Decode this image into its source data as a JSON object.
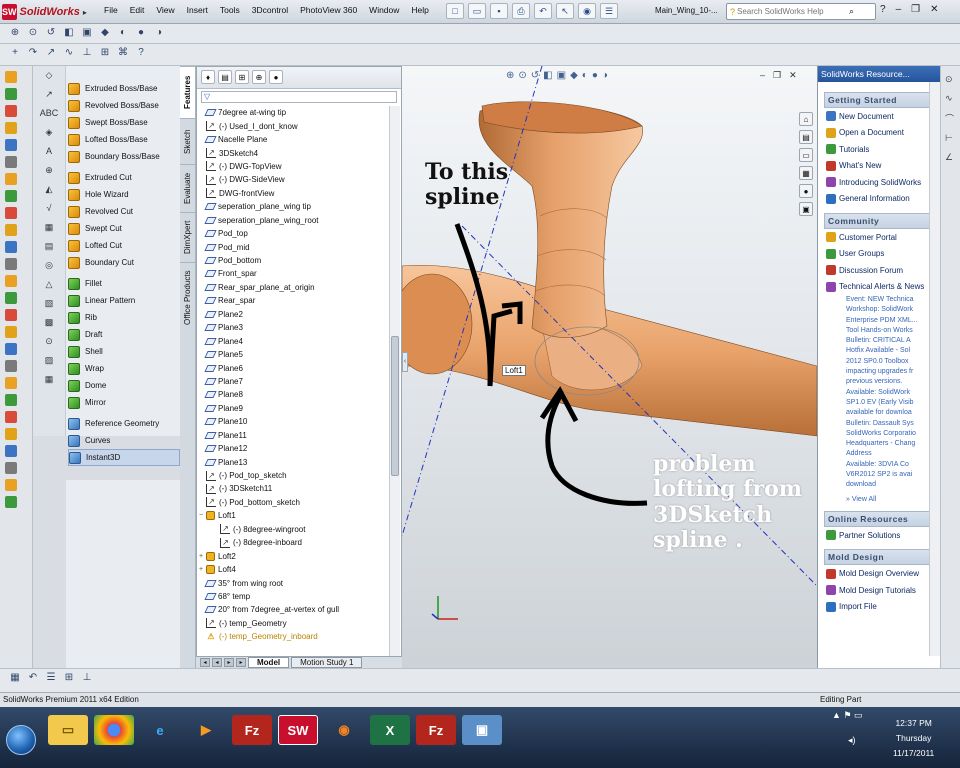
{
  "app": {
    "name": "SolidWorks",
    "badge": "SW",
    "document_title": "Main_Wing_10-..."
  },
  "menu": [
    "File",
    "Edit",
    "View",
    "Insert",
    "Tools",
    "3Dcontrol",
    "PhotoView 360",
    "Window",
    "Help"
  ],
  "search": {
    "placeholder": "Search SolidWorks Help"
  },
  "commands": {
    "group1": [
      "Extruded Boss/Base",
      "Revolved Boss/Base",
      "Swept Boss/Base",
      "Lofted Boss/Base",
      "Boundary Boss/Base"
    ],
    "group2": [
      "Extruded Cut",
      "Hole Wizard",
      "Revolved Cut",
      "Swept Cut",
      "Lofted Cut",
      "Boundary Cut"
    ],
    "group3": [
      "Fillet",
      "Linear Pattern",
      "Rib",
      "Draft",
      "Shell",
      "Wrap",
      "Dome",
      "Mirror"
    ],
    "group4": [
      "Reference Geometry",
      "Curves",
      "Instant3D"
    ]
  },
  "vertical_tabs": [
    "Features",
    "Sketch",
    "Evaluate",
    "DimXpert",
    "Office Products"
  ],
  "feature_tree": [
    {
      "type": "plane",
      "label": "7degree at-wing tip"
    },
    {
      "type": "sketch",
      "label": "(-) Used_I_dont_know"
    },
    {
      "type": "plane",
      "label": "Nacelle Plane"
    },
    {
      "type": "sketch",
      "label": "3DSketch4"
    },
    {
      "type": "sketch",
      "label": "(-) DWG-TopView"
    },
    {
      "type": "sketch",
      "label": "(-) DWG-SideView"
    },
    {
      "type": "sketch",
      "label": "DWG-frontView"
    },
    {
      "type": "plane",
      "label": "seperation_plane_wing tip"
    },
    {
      "type": "plane",
      "label": "seperation_plane_wing_root"
    },
    {
      "type": "plane",
      "label": "Pod_top"
    },
    {
      "type": "plane",
      "label": "Pod_mid"
    },
    {
      "type": "plane",
      "label": "Pod_bottom"
    },
    {
      "type": "plane",
      "label": "Front_spar"
    },
    {
      "type": "plane",
      "label": "Rear_spar_plane_at_origin"
    },
    {
      "type": "plane",
      "label": "Rear_spar"
    },
    {
      "type": "plane",
      "label": "Plane2"
    },
    {
      "type": "plane",
      "label": "Plane3"
    },
    {
      "type": "plane",
      "label": "Plane4"
    },
    {
      "type": "plane",
      "label": "Plane5"
    },
    {
      "type": "plane",
      "label": "Plane6"
    },
    {
      "type": "plane",
      "label": "Plane7"
    },
    {
      "type": "plane",
      "label": "Plane8"
    },
    {
      "type": "plane",
      "label": "Plane9"
    },
    {
      "type": "plane",
      "label": "Plane10"
    },
    {
      "type": "plane",
      "label": "Plane11"
    },
    {
      "type": "plane",
      "label": "Plane12"
    },
    {
      "type": "plane",
      "label": "Plane13"
    },
    {
      "type": "sketch",
      "label": "(-) Pod_top_sketch"
    },
    {
      "type": "sketch",
      "label": "(-) 3DSketch11"
    },
    {
      "type": "sketch",
      "label": "(-) Pod_bottom_sketch"
    },
    {
      "type": "loft",
      "label": "Loft1",
      "expand": "−"
    },
    {
      "type": "sketch",
      "label": "(-) 8degree-wingroot",
      "child": true
    },
    {
      "type": "sketch",
      "label": "(-) 8degree-inboard",
      "child": true
    },
    {
      "type": "loft",
      "label": "Loft2",
      "expand": "+"
    },
    {
      "type": "loft",
      "label": "Loft4",
      "expand": "+"
    },
    {
      "type": "plane",
      "label": "35° from wing root"
    },
    {
      "type": "plane",
      "label": "68° temp"
    },
    {
      "type": "plane",
      "label": "20° from 7degree_at-vertex of gull"
    },
    {
      "type": "sketch",
      "label": "(-) temp_Geometry"
    },
    {
      "type": "warn",
      "label": "(-) temp_Geometry_inboard"
    }
  ],
  "tree_tabs": [
    "Model",
    "Motion Study 1"
  ],
  "viewport": {
    "annotation_top": "To this\nspline",
    "annotation_bottom": "problem\nlofting from\n3DSketch\nspline .",
    "callout": "Loft1"
  },
  "resources": {
    "header": "SolidWorks Resource...",
    "sections": [
      {
        "title": "Getting Started",
        "items": [
          "New Document",
          "Open a Document",
          "Tutorials",
          "What's New",
          "Introducing SolidWorks",
          "General Information"
        ]
      },
      {
        "title": "Community",
        "items": [
          "Customer Portal",
          "User Groups",
          "Discussion Forum",
          "Technical Alerts & News"
        ]
      },
      {
        "title": "Online Resources",
        "items": [
          "Partner Solutions"
        ]
      },
      {
        "title": "Mold Design",
        "items": [
          "Mold Design Overview",
          "Mold Design Tutorials",
          "Import File"
        ]
      }
    ],
    "news": [
      "Event: NEW Technica",
      "Workshop: SolidWork",
      "Enterprise PDM XML...",
      "Tool Hands-on Works",
      "Bulletin: CRITICAL A",
      "Hotfix Available - Sol",
      "2012 SP0.0 Toolbox",
      "impacting upgrades fr",
      "previous versions.",
      "Available: SolidWork",
      "SP1.0 EV (Early Visib",
      "available for downloa",
      "Bulletin: Dassault Sys",
      "SolidWorks Corporatio",
      "Headquarters - Chang",
      "Address",
      "Available: 3DVIA Co",
      "V6R2012 SP2 is avai",
      "download"
    ],
    "view_all": "» View All"
  },
  "status": {
    "left": "SolidWorks Premium 2011 x64 Edition",
    "right": "Editing Part"
  },
  "clock": {
    "time": "12:37 PM",
    "day": "Thursday",
    "date": "11/17/2011"
  },
  "colors": {
    "part": "#e9a36b",
    "accent": "#24549d",
    "brand": "#c8102e"
  }
}
